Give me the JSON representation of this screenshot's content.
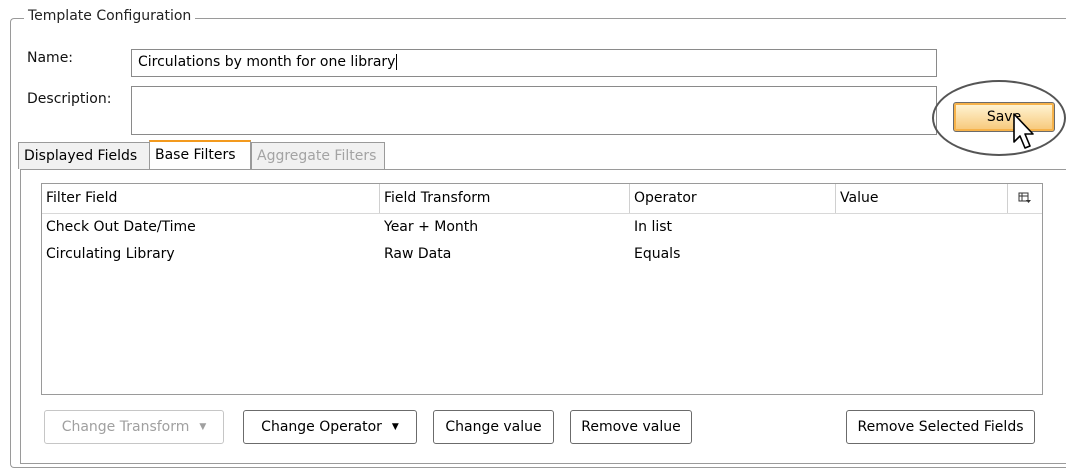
{
  "fieldset": {
    "legend": "Template Configuration"
  },
  "name": {
    "label": "Name:",
    "value": "Circulations by month for one library"
  },
  "description": {
    "label": "Description:",
    "value": ""
  },
  "save_label": "Save",
  "tabs": [
    {
      "label": "Displayed Fields",
      "state": "normal"
    },
    {
      "label": "Base Filters",
      "state": "active"
    },
    {
      "label": "Aggregate Filters",
      "state": "disabled"
    }
  ],
  "grid": {
    "columns": [
      "Filter Field",
      "Field Transform",
      "Operator",
      "Value"
    ],
    "column_picker_icon": "column-picker-icon",
    "rows": [
      [
        "Check Out Date/Time",
        "Year + Month",
        "In list",
        ""
      ],
      [
        "Circulating Library",
        "Raw Data",
        "Equals",
        ""
      ]
    ]
  },
  "buttons": {
    "change_transform": "Change Transform",
    "change_operator": "Change Operator",
    "change_value": "Change value",
    "remove_value": "Remove value",
    "remove_selected": "Remove Selected Fields"
  },
  "colors": {
    "active_tab_accent": "#f39a1e",
    "save_fill": "#f7c777"
  }
}
